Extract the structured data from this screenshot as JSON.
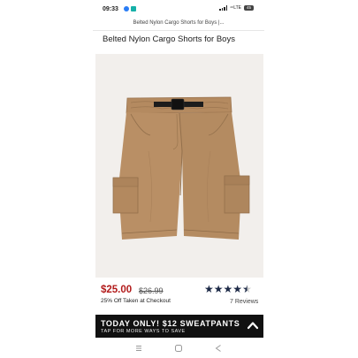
{
  "status_bar": {
    "time": "09:33",
    "network": "⁴⁶LTE",
    "battery": "45",
    "app_icons": [
      "messenger-icon",
      "app-icon"
    ]
  },
  "browser": {
    "url_title": "Belted Nylon Cargo Shorts for Boys |..."
  },
  "product": {
    "title": "Belted Nylon Cargo Shorts for Boys",
    "image_icon": "cargo-shorts-image",
    "sale_price": "$25.00",
    "original_price": "$26.99",
    "promo": "25% Off Taken at Checkout",
    "rating": 4.5,
    "rating_max": 5,
    "reviews": "7 Reviews"
  },
  "banner": {
    "title": "TODAY ONLY! $12 SWEATPANTS",
    "subtitle": "TAP FOR MORE WAYS TO SAVE"
  },
  "nav_bar": {
    "icons": [
      "recent-apps-icon",
      "home-icon",
      "back-icon"
    ]
  },
  "colors": {
    "sale_red": "#b21a1a",
    "star_navy": "#1d2a47",
    "banner_black": "#111111",
    "product_khaki": "#b98f65"
  }
}
